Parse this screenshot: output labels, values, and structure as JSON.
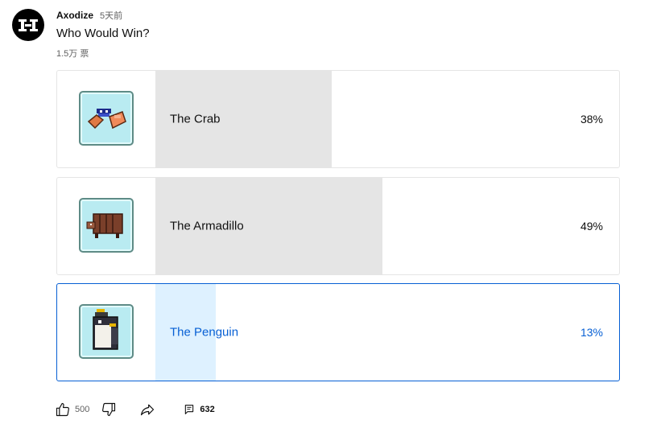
{
  "post": {
    "author": "Axodize",
    "time": "5天前",
    "question": "Who Would Win?",
    "votes": "1.5万 票"
  },
  "poll": {
    "options": [
      {
        "label": "The Crab",
        "percent_text": "38%",
        "percent": 38,
        "icon": "crab-icon",
        "selected": false
      },
      {
        "label": "The Armadillo",
        "percent_text": "49%",
        "percent": 49,
        "icon": "armadillo-icon",
        "selected": false
      },
      {
        "label": "The Penguin",
        "percent_text": "13%",
        "percent": 13,
        "icon": "penguin-icon",
        "selected": true
      }
    ]
  },
  "actions": {
    "like_count": "500",
    "comment_count": "632"
  },
  "colors": {
    "selected_accent": "#065fd4",
    "bar_fill": "#e5e5e5",
    "selected_bar_fill": "#def1ff"
  }
}
